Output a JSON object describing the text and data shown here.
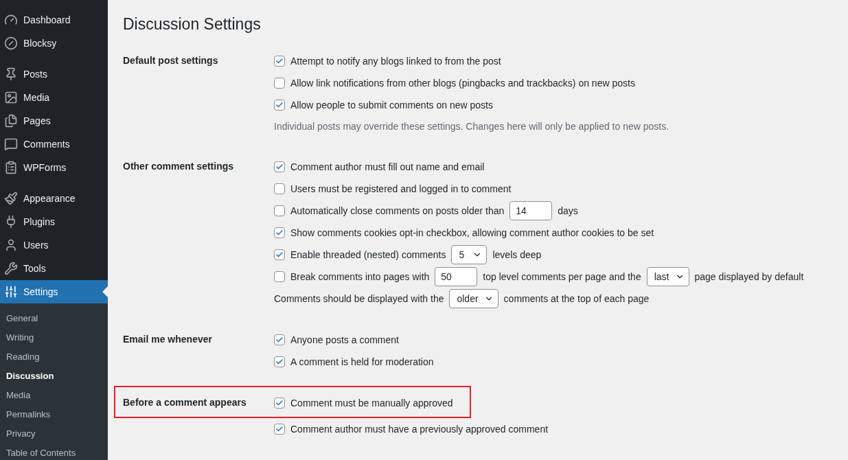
{
  "sidebar": {
    "groups": [
      {
        "items": [
          {
            "label": "Dashboard",
            "selected": false
          },
          {
            "label": "Blocksy",
            "selected": false
          }
        ]
      },
      {
        "items": [
          {
            "label": "Posts",
            "selected": false
          },
          {
            "label": "Media",
            "selected": false
          },
          {
            "label": "Pages",
            "selected": false
          },
          {
            "label": "Comments",
            "selected": false
          },
          {
            "label": "WPForms",
            "selected": false
          }
        ]
      },
      {
        "items": [
          {
            "label": "Appearance",
            "selected": false
          },
          {
            "label": "Plugins",
            "selected": false
          },
          {
            "label": "Users",
            "selected": false
          },
          {
            "label": "Tools",
            "selected": false
          },
          {
            "label": "Settings",
            "selected": true
          }
        ]
      }
    ],
    "submenu": [
      {
        "label": "General",
        "selected": false
      },
      {
        "label": "Writing",
        "selected": false
      },
      {
        "label": "Reading",
        "selected": false
      },
      {
        "label": "Discussion",
        "selected": true
      },
      {
        "label": "Media",
        "selected": false
      },
      {
        "label": "Permalinks",
        "selected": false
      },
      {
        "label": "Privacy",
        "selected": false
      },
      {
        "label": "Table of Contents",
        "selected": false
      }
    ]
  },
  "page": {
    "title": "Discussion Settings",
    "sections": [
      {
        "label": "Default post settings",
        "highlighted": false,
        "rows": [
          {
            "kind": "checkbox",
            "checked": true,
            "parts": [
              {
                "text": "Attempt to notify any blogs linked to from the post"
              }
            ]
          },
          {
            "kind": "checkbox",
            "checked": false,
            "parts": [
              {
                "text": "Allow link notifications from other blogs (pingbacks and trackbacks) on new posts"
              }
            ]
          },
          {
            "kind": "checkbox",
            "checked": true,
            "parts": [
              {
                "text": "Allow people to submit comments on new posts"
              }
            ]
          },
          {
            "kind": "note",
            "text": "Individual posts may override these settings. Changes here will only be applied to new posts."
          }
        ]
      },
      {
        "label": "Other comment settings",
        "highlighted": false,
        "rows": [
          {
            "kind": "checkbox",
            "checked": true,
            "parts": [
              {
                "text": "Comment author must fill out name and email"
              }
            ]
          },
          {
            "kind": "checkbox",
            "checked": false,
            "parts": [
              {
                "text": "Users must be registered and logged in to comment"
              }
            ]
          },
          {
            "kind": "checkbox",
            "checked": false,
            "parts": [
              {
                "text": "Automatically close comments on posts older than"
              },
              {
                "input_value": "14"
              },
              {
                "text": "days"
              }
            ]
          },
          {
            "kind": "checkbox",
            "checked": true,
            "parts": [
              {
                "text": "Show comments cookies opt-in checkbox, allowing comment author cookies to be set"
              }
            ]
          },
          {
            "kind": "checkbox",
            "checked": true,
            "parts": [
              {
                "text": "Enable threaded (nested) comments"
              },
              {
                "select_value": "5"
              },
              {
                "text": "levels deep"
              }
            ]
          },
          {
            "kind": "checkbox",
            "checked": false,
            "parts": [
              {
                "text": "Break comments into pages with"
              },
              {
                "input_value": "50"
              },
              {
                "text": "top level comments per page and the"
              },
              {
                "select_value": "last"
              },
              {
                "text": "page displayed by default"
              }
            ]
          },
          {
            "kind": "plain",
            "parts": [
              {
                "text": "Comments should be displayed with the"
              },
              {
                "select_value": "older"
              },
              {
                "text": "comments at the top of each page"
              }
            ]
          }
        ]
      },
      {
        "label": "Email me whenever",
        "highlighted": false,
        "rows": [
          {
            "kind": "checkbox",
            "checked": true,
            "parts": [
              {
                "text": "Anyone posts a comment"
              }
            ]
          },
          {
            "kind": "checkbox",
            "checked": true,
            "parts": [
              {
                "text": "A comment is held for moderation"
              }
            ]
          }
        ]
      },
      {
        "label": "Before a comment appears",
        "highlighted": true,
        "rows": [
          {
            "kind": "checkbox",
            "checked": true,
            "parts": [
              {
                "text": "Comment must be manually approved"
              }
            ]
          },
          {
            "kind": "checkbox",
            "checked": true,
            "parts": [
              {
                "text": "Comment author must have a previously approved comment"
              }
            ]
          }
        ]
      }
    ]
  }
}
